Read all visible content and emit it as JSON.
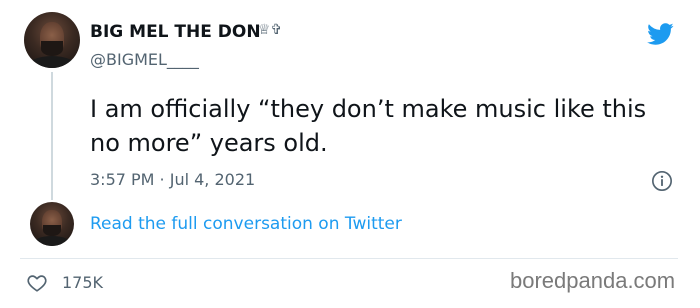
{
  "tweet": {
    "display_name": "BIG MEL THE DON",
    "name_emoji": "♕✞",
    "handle": "@BIGMEL____",
    "text": "I am officially “they don’t make music like this no more” years old.",
    "timestamp": "3:57 PM · Jul 4, 2021",
    "read_more": "Read the full conversation on Twitter",
    "likes": "175K"
  },
  "icons": {
    "logo": "twitter-bird-icon",
    "info": "info-icon",
    "like": "heart-icon"
  },
  "colors": {
    "twitter_blue": "#1d9bf0",
    "secondary_text": "#536471",
    "primary_text": "#0f1419"
  },
  "watermark": "boredpanda.com"
}
